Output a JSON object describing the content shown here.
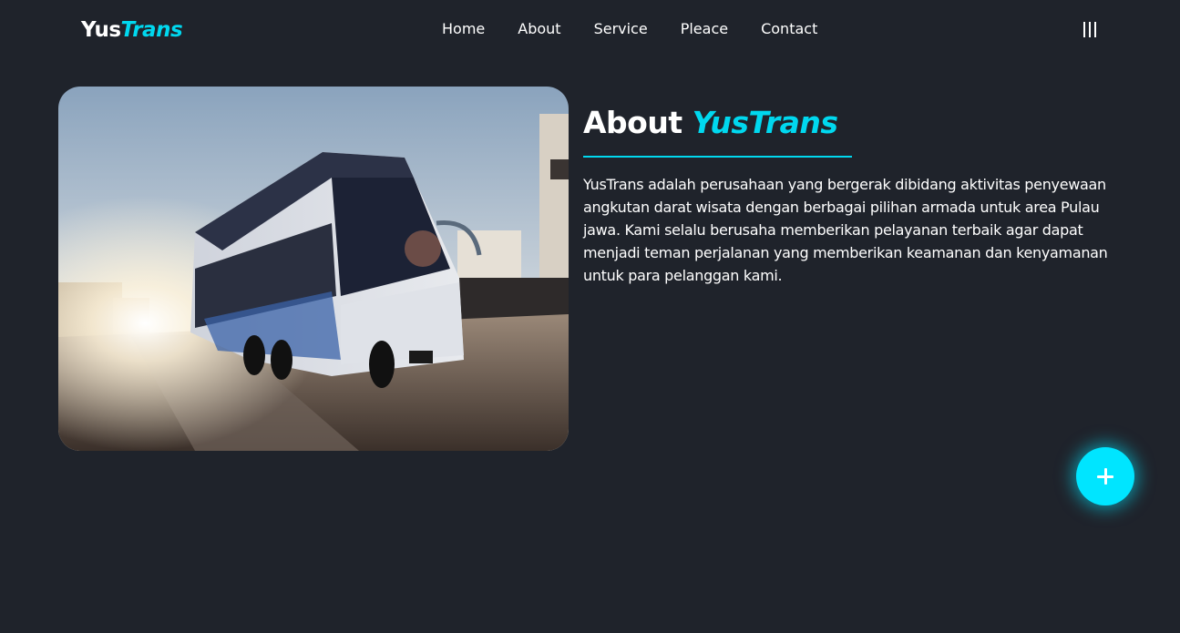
{
  "brand": {
    "name_main": "Yus",
    "name_accent": "Trans"
  },
  "nav": {
    "items": [
      {
        "label": "Home"
      },
      {
        "label": "About"
      },
      {
        "label": "Service"
      },
      {
        "label": "Pleace"
      },
      {
        "label": "Contact"
      }
    ]
  },
  "menu": {
    "icon": "menu-bars-icon"
  },
  "about": {
    "title_main": "About ",
    "title_accent": "YusTrans",
    "paragraph": "YusTrans adalah perusahaan yang bergerak dibidang aktivitas penyewaan angkutan darat wisata dengan berbagai pilihan armada untuk area Pulau jawa. Kami selalu berusaha memberikan pelayanan terbaik agar dapat menjadi teman perjalanan yang memberikan keamanan dan kenyamanan untuk para pelanggan kami."
  },
  "fab": {
    "icon": "plus-icon"
  },
  "colors": {
    "background": "#1f232b",
    "accent": "#00d8ef",
    "fab": "#00e5ff"
  }
}
